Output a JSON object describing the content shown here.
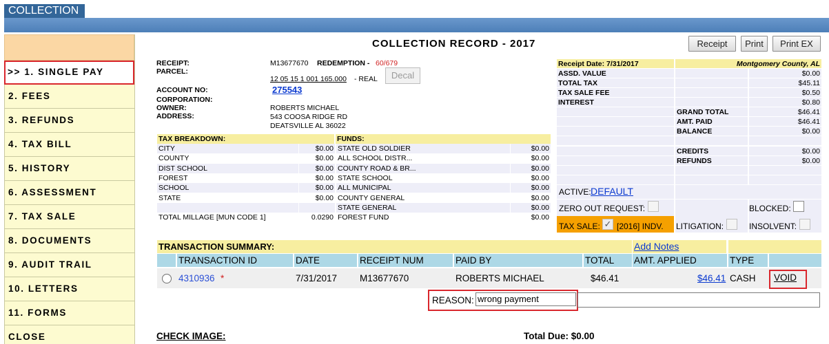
{
  "app": {
    "tab_label": "COLLECTION"
  },
  "sidebar": {
    "items": [
      {
        "label": ">> 1. SINGLE PAY"
      },
      {
        "label": "2. FEES"
      },
      {
        "label": "3. REFUNDS"
      },
      {
        "label": "4. TAX BILL"
      },
      {
        "label": "5. HISTORY"
      },
      {
        "label": "6. ASSESSMENT"
      },
      {
        "label": "7. TAX SALE"
      },
      {
        "label": "8. DOCUMENTS"
      },
      {
        "label": "9. AUDIT TRAIL"
      },
      {
        "label": "10. LETTERS"
      },
      {
        "label": "11. FORMS"
      },
      {
        "label": "CLOSE"
      }
    ]
  },
  "header": {
    "title": "COLLECTION RECORD - 2017",
    "receipt_btn": "Receipt",
    "print_btn": "Print",
    "print_ex_btn": "Print EX"
  },
  "record": {
    "receipt_label": "RECEIPT:",
    "receipt_value": "M13677670",
    "redemption_label": "REDEMPTION -",
    "redemption_value": "60/679",
    "parcel_label": "PARCEL:",
    "parcel_value": "12 05 15 1 001 165.000",
    "parcel_suffix": "- REAL",
    "decal_btn": "Decal",
    "account_label": "ACCOUNT NO:",
    "account_value": "275543",
    "corporation_label": "CORPORATION:",
    "owner_label": "OWNER:",
    "owner_value": "ROBERTS MICHAEL",
    "address_label": "ADDRESS:",
    "address_line1": "543 COOSA RIDGE RD",
    "address_line2": "DEATSVILLE AL  36022"
  },
  "tax_breakdown": {
    "header": "TAX BREAKDOWN:",
    "funds_header": "FUNDS:",
    "rows": [
      {
        "name": "CITY",
        "amount": "$0.00",
        "fund": "STATE OLD SOLDIER",
        "fund_amount": "$0.00"
      },
      {
        "name": "COUNTY",
        "amount": "$0.00",
        "fund": "ALL SCHOOL DISTR...",
        "fund_amount": "$0.00"
      },
      {
        "name": "DIST SCHOOL",
        "amount": "$0.00",
        "fund": "COUNTY ROAD & BR...",
        "fund_amount": "$0.00"
      },
      {
        "name": "FOREST",
        "amount": "$0.00",
        "fund": "STATE SCHOOL",
        "fund_amount": "$0.00"
      },
      {
        "name": "SCHOOL",
        "amount": "$0.00",
        "fund": "ALL MUNICIPAL",
        "fund_amount": "$0.00"
      },
      {
        "name": "STATE",
        "amount": "$0.00",
        "fund": "COUNTY GENERAL",
        "fund_amount": "$0.00"
      },
      {
        "name": "",
        "amount": "",
        "fund": "STATE GENERAL",
        "fund_amount": "$0.00"
      },
      {
        "name": "TOTAL MILLAGE [MUN CODE 1]",
        "amount": "0.0290",
        "fund": "FOREST FUND",
        "fund_amount": "$0.00"
      }
    ]
  },
  "summary": {
    "receipt_date": "Receipt Date: 7/31/2017",
    "county": "Montgomery County, AL",
    "assd_value_label": "ASSD. VALUE",
    "assd_value": "$0.00",
    "total_tax_label": "TOTAL TAX",
    "total_tax": "$45.11",
    "tax_sale_fee_label": "TAX SALE FEE",
    "tax_sale_fee": "$0.50",
    "interest_label": "INTEREST",
    "interest": "$0.80",
    "grand_total_label": "GRAND TOTAL",
    "grand_total": "$46.41",
    "amt_paid_label": "AMT. PAID",
    "amt_paid": "$46.41",
    "balance_label": "BALANCE",
    "balance": "$0.00",
    "credits_label": "CREDITS",
    "credits": "$0.00",
    "refunds_label": "REFUNDS",
    "refunds": "$0.00",
    "active_label": "ACTIVE:",
    "active_value": "DEFAULT",
    "zero_out_label": "ZERO OUT REQUEST:",
    "blocked_label": "BLOCKED:",
    "tax_sale_label": "TAX SALE:",
    "tax_sale_value": "[2016] INDV.",
    "litigation_label": "LITIGATION:",
    "insolvent_label": "INSOLVENT:"
  },
  "transactions": {
    "header": "TRANSACTION SUMMARY:",
    "add_notes": "Add Notes",
    "columns": [
      "TRANSACTION ID",
      "DATE",
      "RECEIPT NUM",
      "PAID BY",
      "TOTAL",
      "AMT. APPLIED",
      "TYPE"
    ],
    "row": {
      "id": "4310936",
      "marker": "*",
      "date": "7/31/2017",
      "receipt_num": "M13677670",
      "paid_by": "ROBERTS MICHAEL",
      "total": "$46.41",
      "amt_applied": "$46.41",
      "type": "CASH",
      "void": "VOID"
    },
    "reason_label": "REASON:",
    "reason_value": "wrong payment"
  },
  "footer": {
    "check_image": "CHECK IMAGE:",
    "total_due": "Total Due: $0.00"
  }
}
